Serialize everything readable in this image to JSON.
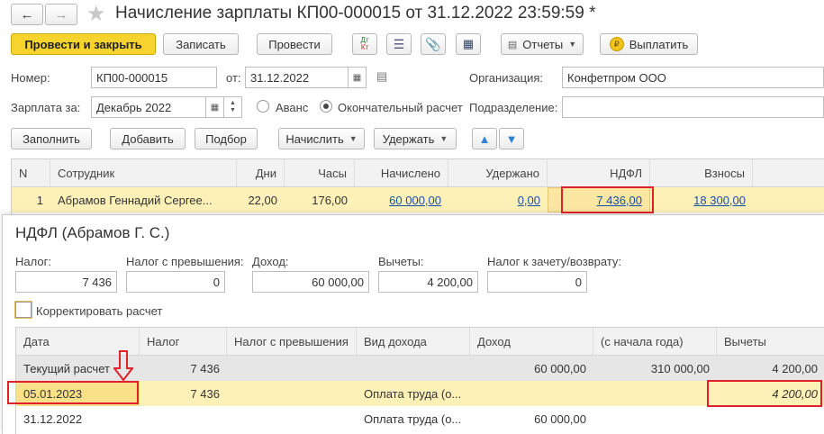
{
  "window": {
    "title": "Начисление зарплаты КП00-000015 от 31.12.2022 23:59:59 *"
  },
  "toolbar": {
    "post_close": "Провести и закрыть",
    "save": "Записать",
    "post": "Провести",
    "dt_kt": "Дт Кт",
    "reports": "Отчеты",
    "pay": "Выплатить"
  },
  "form": {
    "number_label": "Номер:",
    "number_value": "КП00-000015",
    "date_label": "от:",
    "date_value": "31.12.2022",
    "org_label": "Организация:",
    "org_value": "Конфетпром ООО",
    "salary_for_label": "Зарплата за:",
    "salary_for_value": "Декабрь 2022",
    "advance_label": "Аванс",
    "final_label": "Окончательный расчет",
    "dept_label": "Подразделение:"
  },
  "actions": {
    "fill": "Заполнить",
    "add": "Добавить",
    "pick": "Подбор",
    "accrue": "Начислить",
    "withhold": "Удержать"
  },
  "main_table": {
    "columns": [
      "N",
      "Сотрудник",
      "Дни",
      "Часы",
      "Начислено",
      "Удержано",
      "НДФЛ",
      "Взносы"
    ],
    "row": {
      "n": "1",
      "employee": "Абрамов Геннадий Сергее...",
      "days": "22,00",
      "hours": "176,00",
      "accrued": "60 000,00",
      "withheld": "0,00",
      "ndfl": "7 436,00",
      "contributions": "18 300,00"
    }
  },
  "ndfl_panel": {
    "title": "НДФЛ (Абрамов Г. С.)",
    "tax_label": "Налог:",
    "tax_value": "7 436",
    "excess_label": "Налог с превышения:",
    "excess_value": "0",
    "income_label": "Доход:",
    "income_value": "60 000,00",
    "deductions_label": "Вычеты:",
    "deductions_value": "4 200,00",
    "offset_label": "Налог к зачету/возврату:",
    "offset_value": "0",
    "adjust_label": "Корректировать расчет"
  },
  "detail_table": {
    "columns": [
      "Дата",
      "Налог",
      "Налог с превышения",
      "Вид дохода",
      "Доход",
      "(с начала года)",
      "Вычеты"
    ],
    "rows": [
      {
        "date": "Текущий расчет",
        "tax": "7 436",
        "excess": "",
        "kind": "",
        "income": "60 000,00",
        "ytd": "310 000,00",
        "deductions": "4 200,00"
      },
      {
        "date": "05.01.2023",
        "tax": "7 436",
        "excess": "",
        "kind": "Оплата труда (о...",
        "income": "",
        "ytd": "",
        "deductions": "4 200,00"
      },
      {
        "date": "31.12.2022",
        "tax": "",
        "excess": "",
        "kind": "Оплата труда (о...",
        "income": "60 000,00",
        "ytd": "",
        "deductions": ""
      }
    ]
  },
  "colors": {
    "primary": "#f6d32d",
    "highlight": "#fdf1b8",
    "selected": "#fbe7a1",
    "annotation": "#e0202a",
    "link": "#1a4fa8"
  }
}
